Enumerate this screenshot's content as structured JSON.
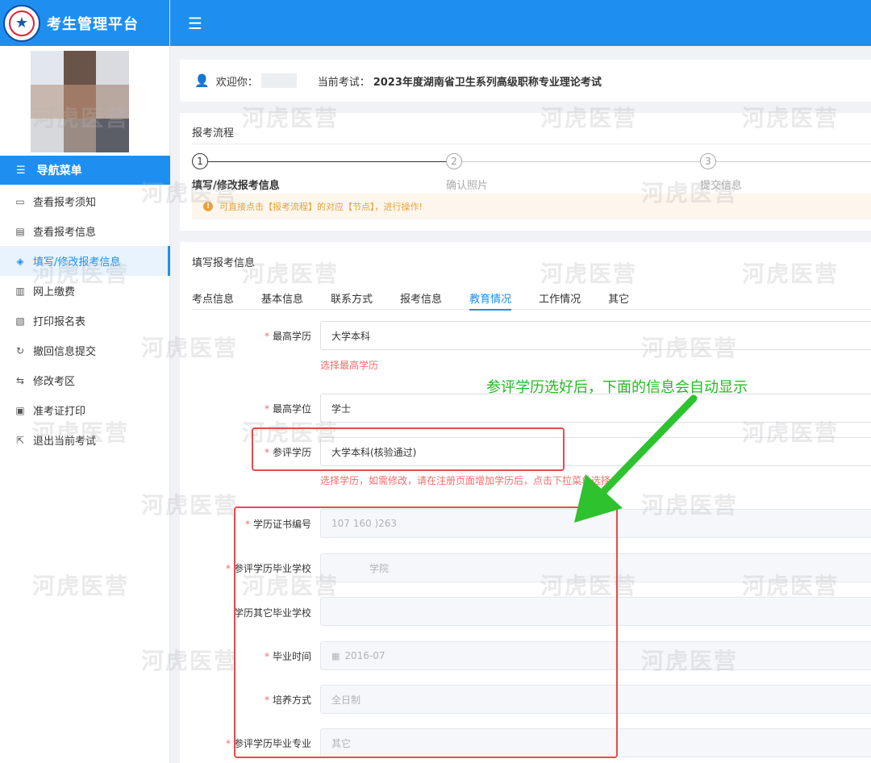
{
  "app": {
    "title": "考生管理平台"
  },
  "sidebar": {
    "nav_header": "导航菜单",
    "items": [
      {
        "label": "查看报考须知",
        "icon": "chat-icon"
      },
      {
        "label": "查看报考信息",
        "icon": "document-icon"
      },
      {
        "label": "填写/修改报考信息",
        "icon": "shield-check-icon",
        "active": true
      },
      {
        "label": "网上缴费",
        "icon": "receipt-icon"
      },
      {
        "label": "打印报名表",
        "icon": "print-form-icon"
      },
      {
        "label": "撤回信息提交",
        "icon": "undo-icon"
      },
      {
        "label": "修改考区",
        "icon": "swap-icon"
      },
      {
        "label": "准考证打印",
        "icon": "id-card-icon"
      },
      {
        "label": "退出当前考试",
        "icon": "exit-icon"
      }
    ]
  },
  "welcome": {
    "greeting": "欢迎你：",
    "exam_label": "当前考试：",
    "exam_name": "2023年度湖南省卫生系列高级职称专业理论考试"
  },
  "flow": {
    "title": "报考流程",
    "steps": [
      {
        "num": "1",
        "label": "填写/修改报考信息"
      },
      {
        "num": "2",
        "label": "确认照片"
      },
      {
        "num": "3",
        "label": "提交信息"
      }
    ],
    "tip": "可直接点击【报考流程】的对应【节点】，进行操作!"
  },
  "form": {
    "title": "填写报考信息",
    "tabs": [
      "考点信息",
      "基本信息",
      "联系方式",
      "报考信息",
      "教育情况",
      "工作情况",
      "其它"
    ],
    "active_tab": 4,
    "fields": {
      "highest_edu_label": "最高学历",
      "highest_edu_value": "大学本科",
      "highest_edu_help": "选择最高学历",
      "highest_degree_label": "最高学位",
      "highest_degree_value": "学士",
      "eval_edu_label": "参评学历",
      "eval_edu_value": "大学本科(核验通过)",
      "eval_edu_help": "选择学历，如需修改，请在注册页面增加学历后，点击下拉菜单选择",
      "cert_no_label": "学历证书编号",
      "cert_no_value": "107        160   )263",
      "school_label": "参评学历毕业学校",
      "school_value": "学院",
      "other_school_label": "学历其它毕业学校",
      "grad_time_label": "毕业时间",
      "grad_time_value": "2016-07",
      "training_label": "培养方式",
      "training_value": "全日制",
      "major_label": "参评学历毕业专业",
      "major_value": "其它"
    }
  },
  "annotation": {
    "text": "参评学历选好后，下面的信息会自动显示"
  },
  "watermark": "河虎医营",
  "colors": {
    "primary": "#1e8ff0",
    "error": "#f56c6c",
    "annot_red": "#e84a4a",
    "annot_green": "#22bb22"
  }
}
